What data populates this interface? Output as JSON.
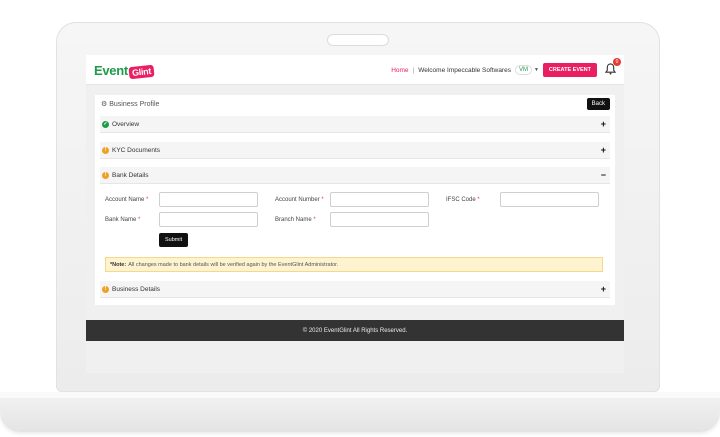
{
  "header": {
    "logo_event": "Event",
    "logo_glint": "Glint",
    "nav_home": "Home",
    "nav_separator": "|",
    "welcome_text": "Welcome Impeccable Softwares",
    "user_initials": "VM",
    "create_event_label": "CREATE EVENT",
    "notification_count": "0"
  },
  "page": {
    "title": "Business Profile",
    "back_label": "Back"
  },
  "sections": {
    "overview": {
      "label": "Overview",
      "toggle": "+"
    },
    "kyc": {
      "label": "KYC Documents",
      "toggle": "+"
    },
    "bank": {
      "label": "Bank Details",
      "toggle": "−"
    },
    "business": {
      "label": "Business Details",
      "toggle": "+"
    }
  },
  "bank_form": {
    "account_name_label": "Account Name",
    "account_number_label": "Account Number",
    "ifsc_code_label": "IFSC Code",
    "bank_name_label": "Bank Name",
    "branch_name_label": "Branch Name",
    "required_mark": "*",
    "submit_label": "Submit"
  },
  "note": {
    "prefix": "*Note:",
    "text": "All changes made to bank details will be verified again by the EventGlint Administrator."
  },
  "footer": {
    "copyright": "© 2020 EventGlint All Rights Reserved."
  },
  "colors": {
    "brand_green": "#1f9b4a",
    "brand_pink": "#e91e63",
    "warning_orange": "#f0a020",
    "footer_bg": "#333333"
  }
}
